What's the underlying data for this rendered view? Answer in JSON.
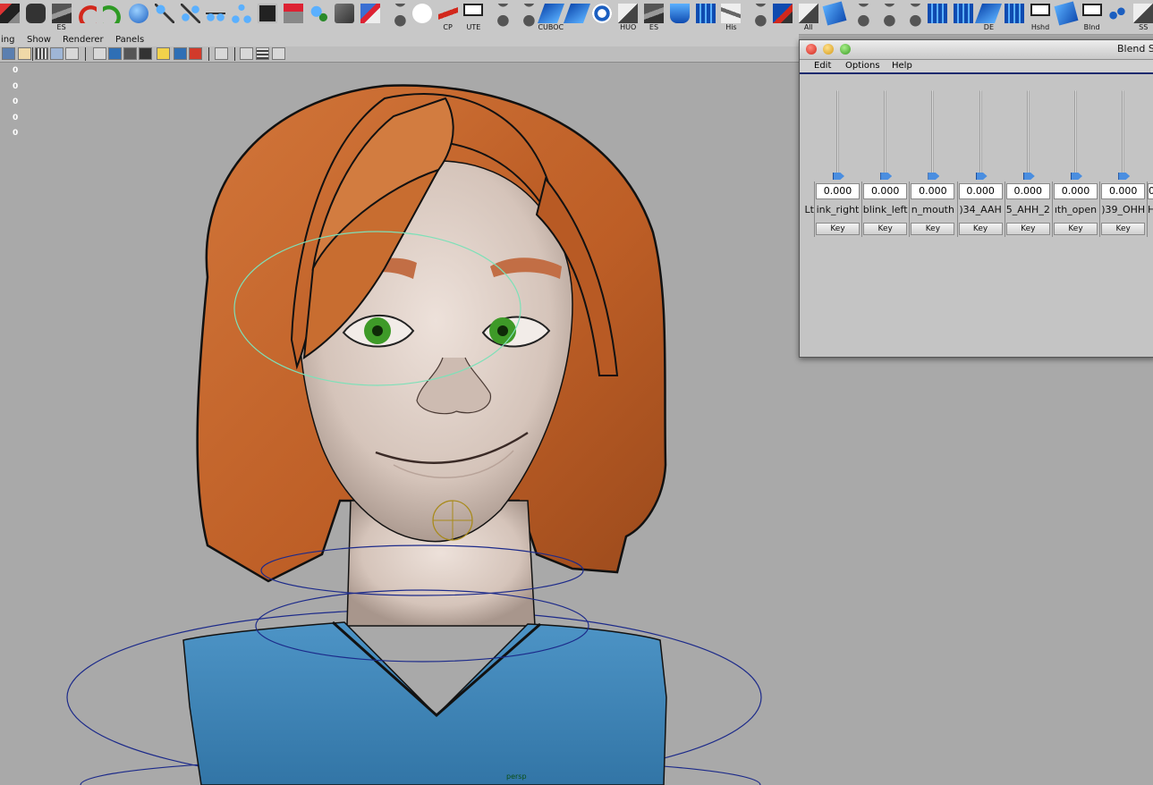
{
  "shelf": {
    "items": [
      {
        "icon": "paint-brush-icon",
        "label": ""
      },
      {
        "icon": "binoculars-icon",
        "label": ""
      },
      {
        "icon": "blade-icon",
        "label": "ES"
      },
      {
        "icon": "red-curve-icon",
        "label": ""
      },
      {
        "icon": "green-curve-icon",
        "label": ""
      },
      {
        "icon": "blue-sphere-icon",
        "label": ""
      },
      {
        "icon": "joint-icon",
        "label": ""
      },
      {
        "icon": "joint-chain-icon",
        "label": ""
      },
      {
        "icon": "joint-branch-icon",
        "label": ""
      },
      {
        "icon": "joint-tree-icon",
        "label": ""
      },
      {
        "icon": "script-editor-icon",
        "label": ""
      },
      {
        "icon": "rig-tool-icon",
        "label": ""
      },
      {
        "icon": "constraint-icon",
        "label": ""
      },
      {
        "icon": "geometry-icon",
        "label": ""
      },
      {
        "icon": "paint-weights-icon",
        "label": ""
      },
      {
        "icon": "mel-script-icon",
        "label": ""
      },
      {
        "icon": "white-circle-icon",
        "label": ""
      },
      {
        "icon": "red-arrow-icon",
        "label": "CP"
      },
      {
        "icon": "empty-box-icon",
        "label": "UTE"
      },
      {
        "icon": "mel-script-icon",
        "label": ""
      },
      {
        "icon": "mel-script-icon",
        "label": ""
      },
      {
        "icon": "blue-plane-icon",
        "label": "CUBOC"
      },
      {
        "icon": "blue-plane-icon",
        "label": ""
      },
      {
        "icon": "target-icon",
        "label": ""
      },
      {
        "icon": "slope-icon",
        "label": "HUO"
      },
      {
        "icon": "blade-icon",
        "label": "ES"
      },
      {
        "icon": "blue-shape-icon",
        "label": ""
      },
      {
        "icon": "blue-grid-icon",
        "label": ""
      },
      {
        "icon": "hand-curve-icon",
        "label": "His"
      },
      {
        "icon": "mel-script-icon",
        "label": ""
      },
      {
        "icon": "deformer-icon",
        "label": ""
      },
      {
        "icon": "slope-icon",
        "label": "All"
      },
      {
        "icon": "blue-cube-icon",
        "label": ""
      },
      {
        "icon": "mel-script-icon",
        "label": ""
      },
      {
        "icon": "mel-script-icon",
        "label": ""
      },
      {
        "icon": "mel-script-icon",
        "label": ""
      },
      {
        "icon": "blue-grid-icon",
        "label": ""
      },
      {
        "icon": "blue-grid-icon",
        "label": ""
      },
      {
        "icon": "blue-plane-icon",
        "label": "DE"
      },
      {
        "icon": "blue-grid-icon",
        "label": ""
      },
      {
        "icon": "empty-box-icon",
        "label": "Hshd"
      },
      {
        "icon": "blue-cube-icon",
        "label": ""
      },
      {
        "icon": "empty-box-icon",
        "label": "Blnd"
      },
      {
        "icon": "blue-dots-icon",
        "label": ""
      },
      {
        "icon": "slope-icon",
        "label": "SS"
      }
    ]
  },
  "panel_menu": {
    "items": [
      "ing",
      "Show",
      "Renderer",
      "Panels"
    ]
  },
  "hud": {
    "values": [
      "0",
      "0",
      "0",
      "0",
      "0"
    ]
  },
  "viewport": {
    "camera_label": "persp"
  },
  "blend_window": {
    "title": "Blend S",
    "menu": [
      "Edit",
      "Options",
      "Help"
    ],
    "partial_left_label": "Lt",
    "partial_right_value": "0",
    "partial_right_label": "H",
    "sliders": [
      {
        "value": "0.000",
        "name": "ink_right",
        "button": "Key",
        "level": 0
      },
      {
        "value": "0.000",
        "name": "blink_left",
        "button": "Key",
        "level": 0
      },
      {
        "value": "0.000",
        "name": "n_mouth",
        "button": "Key",
        "level": 0
      },
      {
        "value": "0.000",
        "name": ")34_AAH",
        "button": "Key",
        "level": 0
      },
      {
        "value": "0.000",
        "name": "5_AHH_2",
        "button": "Key",
        "level": 0
      },
      {
        "value": "0.000",
        "name": "ıth_open",
        "button": "Key",
        "level": 0
      },
      {
        "value": "0.000",
        "name": ")39_OHH",
        "button": "Key",
        "level": 0
      }
    ]
  },
  "colors": {
    "viewport_bg": "#a9a9a9",
    "hair": "#c0622a",
    "skin": "#d9c8be",
    "shirt": "#3f86b8",
    "eyes": "#3e9a28",
    "control_curve": "#1c2a8a",
    "select_curve": "#7ee0b8"
  }
}
